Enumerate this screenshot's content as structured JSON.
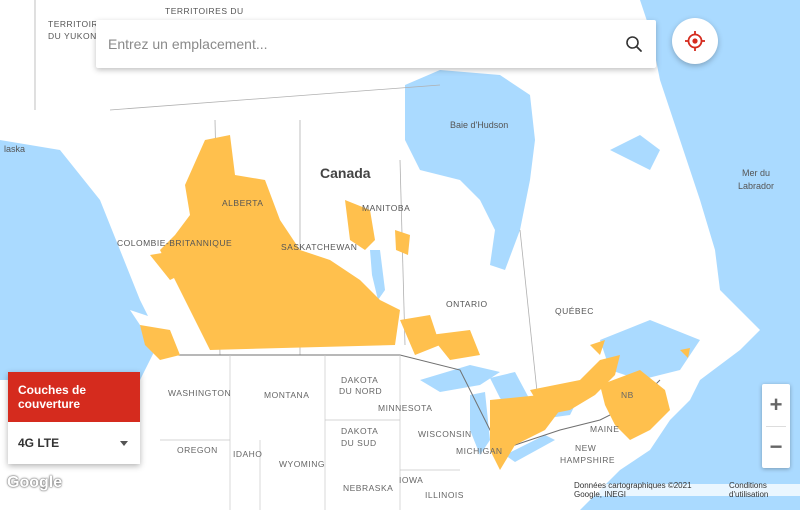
{
  "search": {
    "placeholder": "Entrez un emplacement..."
  },
  "layers_panel": {
    "title": "Couches de couverture",
    "selected": "4G LTE"
  },
  "zoom": {
    "in": "+",
    "out": "−"
  },
  "attribution": {
    "data": "Données cartographiques ©2021 Google, INEGI",
    "terms": "Conditions d'utilisation"
  },
  "logo": "Google",
  "labels": {
    "yukon_1": "TERRITOIRE",
    "yukon_2": "DU YUKON",
    "nwt": "TERRITOIRES DU",
    "alaska": "laska",
    "country": "Canada",
    "hudson": "Baie d'Hudson",
    "labrador_1": "Mer du",
    "labrador_2": "Labrador",
    "alberta": "ALBERTA",
    "bc": "COLOMBIE-BRITANNIQUE",
    "sask": "SASKATCHEWAN",
    "manitoba": "MANITOBA",
    "ontario": "ONTARIO",
    "quebec": "QUÉBEC",
    "washington": "WASHINGTON",
    "montana": "MONTANA",
    "nd_1": "DAKOTA",
    "nd_2": "DU NORD",
    "minnesota": "MINNESOTA",
    "sd_1": "DAKOTA",
    "sd_2": "DU SUD",
    "wisconsin": "WISCONSIN",
    "michigan": "MICHIGAN",
    "oregon": "OREGON",
    "idaho": "IDAHO",
    "wyoming": "WYOMING",
    "nebraska": "NEBRASKA",
    "iowa": "IOWA",
    "illinois": "ILLINOIS",
    "maine": "MAINE",
    "nh_1": "NEW",
    "nh_2": "HAMPSHIRE",
    "nb": "NB"
  },
  "colors": {
    "water": "#aadaff",
    "land": "#ffffff",
    "coverage": "#ffc04d",
    "accent": "#d52b1e"
  },
  "icons": {
    "search": "search-icon",
    "locate": "crosshair-icon",
    "dropdown": "caret-down-icon"
  }
}
